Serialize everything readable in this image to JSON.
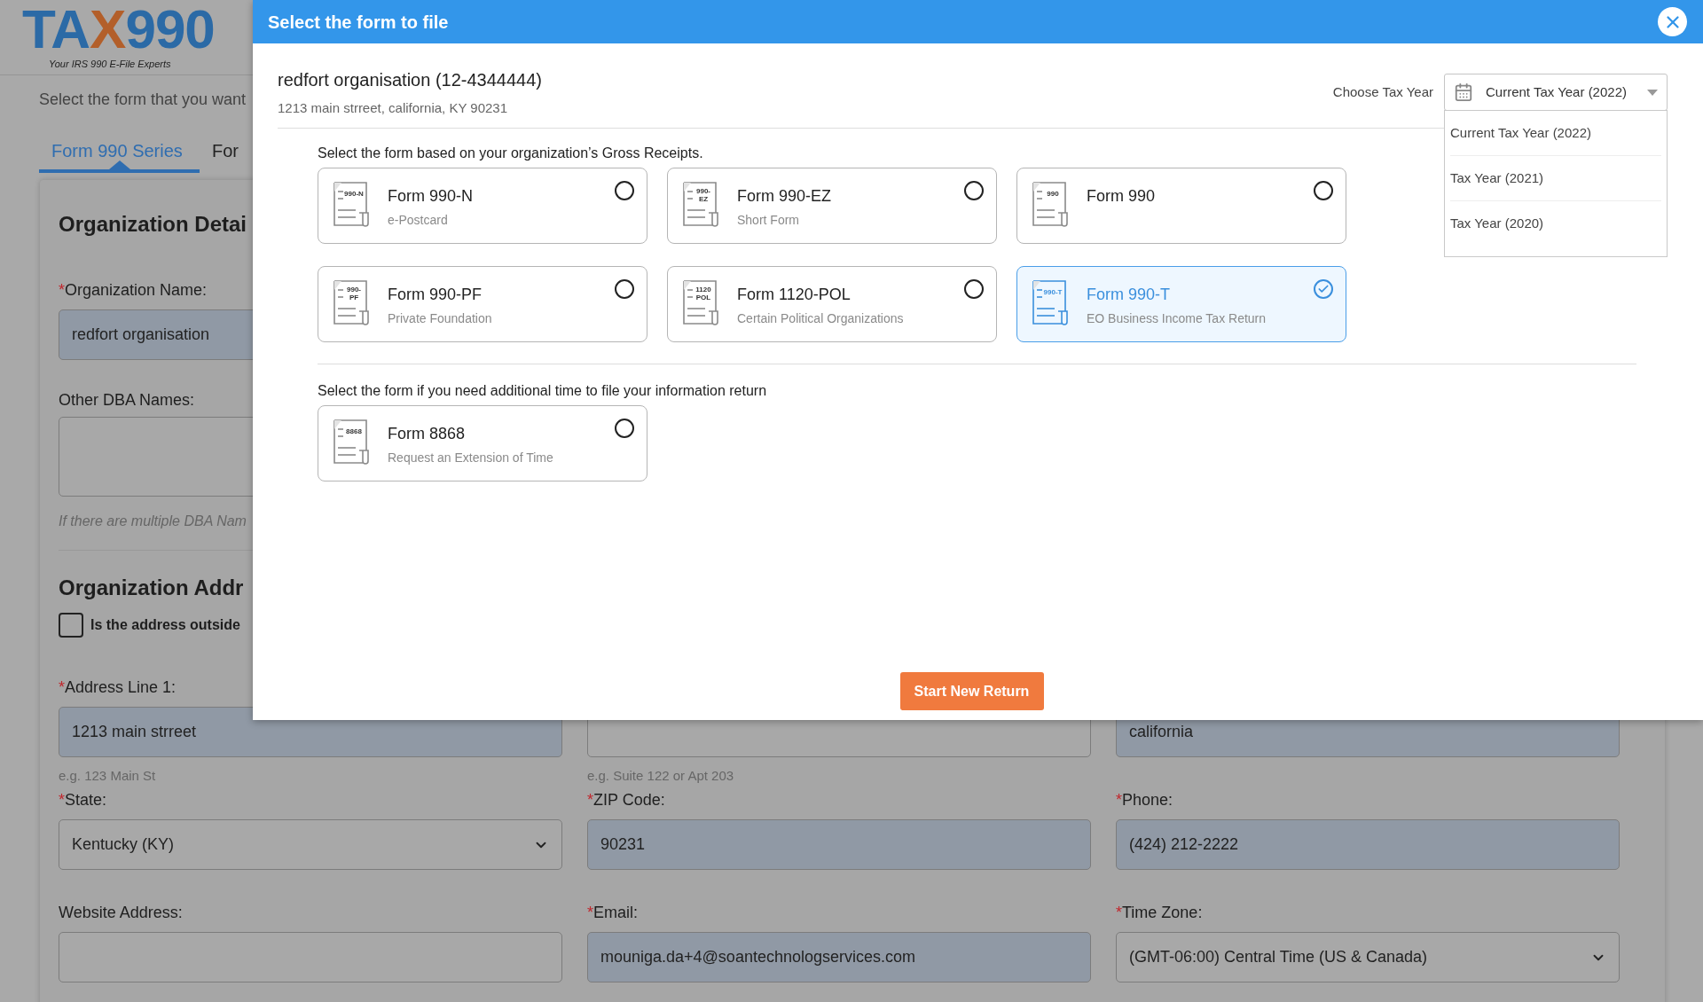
{
  "logo": {
    "start": "TA",
    "mark": "X",
    "end": "990",
    "tagline": "Your IRS 990 E-File Experts"
  },
  "intro": "Select the form that you want",
  "tabs": [
    {
      "label": "Form 990 Series",
      "selected": true
    },
    {
      "label": "For",
      "selected": false
    }
  ],
  "details": {
    "heading": "Organization Detai",
    "name_label": "Organization Name:",
    "name_mark": "*",
    "name_value": "redfort organisation",
    "dba_label": "Other DBA Names:",
    "dba_hint": "If there are multiple DBA Nam"
  },
  "address": {
    "heading": "Organization Addr",
    "outside": {
      "label": "Is the address outside",
      "checked": false
    },
    "rows": [
      [
        {
          "kind": "input",
          "label": "Address Line 1:",
          "mark": "*",
          "value": "1213 main strreet",
          "hint": "e.g. 123 Main St"
        },
        {
          "kind": "input",
          "hint": "e.g. Suite 122 or Apt 203"
        },
        {
          "kind": "input",
          "value": "california"
        }
      ],
      [
        {
          "kind": "select",
          "label": "State:",
          "mark": "*",
          "value": "Kentucky (KY)"
        },
        {
          "kind": "input",
          "label": "ZIP Code:",
          "mark": "*",
          "value": "90231"
        },
        {
          "kind": "input",
          "label": "Phone:",
          "mark": "*",
          "value": "(424) 212-2222"
        }
      ],
      [
        {
          "kind": "input",
          "label": "Website Address:"
        },
        {
          "kind": "input",
          "label": "Email:",
          "mark": "*",
          "value": "mouniga.da+4@soantechnologservices.com"
        },
        {
          "kind": "select",
          "label": "Time Zone:",
          "mark": "*",
          "value": "(GMT-06:00) Central Time (US & Canada)"
        }
      ]
    ]
  },
  "modal": {
    "title": "Select the form to file",
    "org_name": "redfort organisation (12-4344444)",
    "org_address": "1213 main strreet, california, KY 90231",
    "tax_year": {
      "label": "Choose Tax Year",
      "value": "Current Tax Year (2022)",
      "expanded": true,
      "options": [
        "Current Tax Year (2022)",
        "Tax Year (2021)",
        "Tax Year (2020)"
      ]
    },
    "groups": [
      {
        "heading": "Select the form based on your organization’s Gross Receipts.",
        "forms": [
          {
            "name": "Form 990-N",
            "description": "e-Postcard",
            "icon_text": [
              "990-N"
            ],
            "selected": false
          },
          {
            "name": "Form 990-EZ",
            "description": "Short Form",
            "icon_text": [
              "990-",
              "EZ"
            ],
            "selected": false
          },
          {
            "name": "Form 990",
            "icon_text": [
              "990"
            ],
            "selected": false
          },
          {
            "name": "Form 990-PF",
            "description": "Private Foundation",
            "icon_text": [
              "990-",
              "PF"
            ],
            "selected": false
          },
          {
            "name": "Form 1120-POL",
            "description": "Certain Political Organizations",
            "icon_text": [
              "1120",
              "POL"
            ],
            "selected": false
          },
          {
            "name": "Form 990-T",
            "description": "EO Business Income Tax Return",
            "icon_text": [
              "990-T"
            ],
            "selected": true
          }
        ]
      },
      {
        "heading": "Select the form if you need additional time to file your information return",
        "forms": [
          {
            "name": "Form 8868",
            "description": "Request an Extension of Time",
            "icon_text": [
              "8868"
            ],
            "selected": false
          }
        ]
      }
    ],
    "start_button": "Start New Return"
  }
}
